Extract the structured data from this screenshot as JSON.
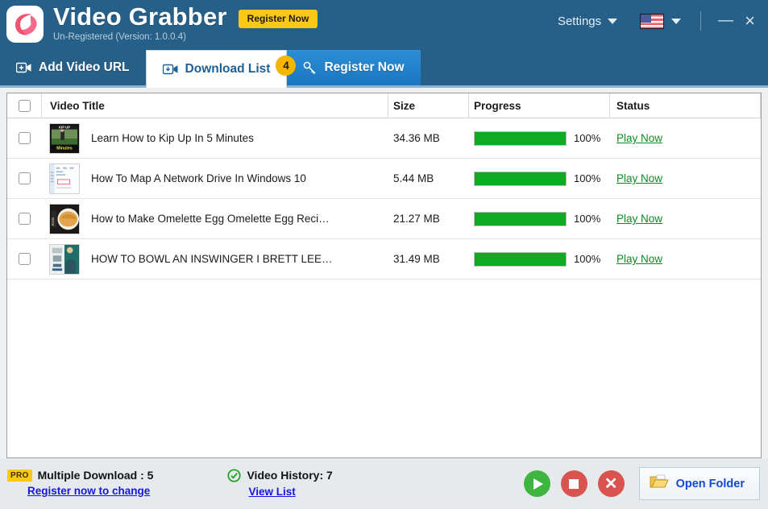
{
  "header": {
    "app_title": "Video Grabber",
    "version_line": "Un-Registered (Version: 1.0.0.4)",
    "register_button": "Register Now",
    "settings_label": "Settings",
    "language_flag": "us-flag-icon",
    "minimize_label": "—",
    "close_label": "×",
    "bg_color": "#266089",
    "accent_yellow": "#fcc816"
  },
  "tabs": [
    {
      "label": "Add Video URL",
      "icon": "video-camera-plus-icon",
      "active": false,
      "style": "dark"
    },
    {
      "label": "Download List",
      "icon": "video-camera-download-icon",
      "active": true,
      "style": "active",
      "badge": "4"
    },
    {
      "label": "Register Now",
      "icon": "key-icon",
      "active": false,
      "style": "blue"
    }
  ],
  "table": {
    "columns": [
      "Video Title",
      "Size",
      "Progress",
      "Status"
    ],
    "select_all_checked": false,
    "rows": [
      {
        "checked": false,
        "thumb": "kip-up-thumbnail",
        "title": "Learn How to Kip Up In 5 Minutes",
        "size": "34.36 MB",
        "progress": 100,
        "progress_label": "100%",
        "status": "Play Now"
      },
      {
        "checked": false,
        "thumb": "network-drive-thumbnail",
        "title": "How To Map A Network Drive In Windows 10",
        "size": "5.44 MB",
        "progress": 100,
        "progress_label": "100%",
        "status": "Play Now"
      },
      {
        "checked": false,
        "thumb": "omelette-thumbnail",
        "title": "How to Make Omelette  Egg Omelette  Egg Reci…",
        "size": "21.27 MB",
        "progress": 100,
        "progress_label": "100%",
        "status": "Play Now"
      },
      {
        "checked": false,
        "thumb": "cricket-thumbnail",
        "title": "HOW TO BOWL AN INSWINGER I BRETT LEE…",
        "size": "31.49 MB",
        "progress": 100,
        "progress_label": "100%",
        "status": "Play Now"
      }
    ]
  },
  "statusbar": {
    "pro_tag": "PRO",
    "multiple_download": "Multiple Download : 5",
    "register_link": "Register now to change",
    "video_history": "Video History: 7",
    "view_list_link": "View List",
    "open_folder": "Open Folder",
    "buttons": [
      "start-download-button",
      "stop-download-button",
      "delete-download-button"
    ],
    "link_color": "#1515e0",
    "progress_green": "#0eab22"
  }
}
